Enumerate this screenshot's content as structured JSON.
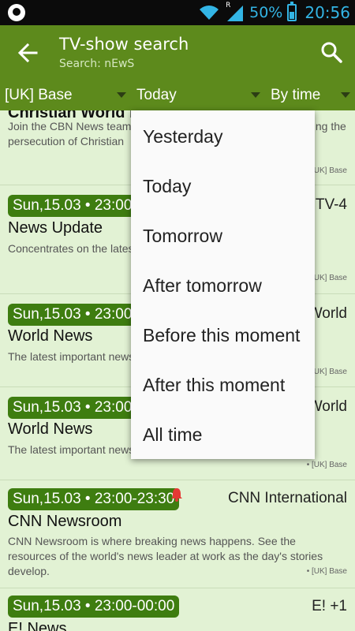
{
  "status_bar": {
    "battery_percent": "50%",
    "time": "20:56",
    "signal_label": "R",
    "accent_color": "#33b5e5"
  },
  "app_bar": {
    "title": "TV-show search",
    "subtitle": "Search: nEwS",
    "color": "#5d8a1c"
  },
  "filters": {
    "base": "[UK] Base",
    "date": "Today",
    "sort": "By time"
  },
  "list": [
    {
      "time": "",
      "channel": "",
      "title": "Christian World News",
      "description": "Join the CBN News team fo                                    f the global church with focus o                                 osing the persecution of Christian",
      "base": "• [UK] Base"
    },
    {
      "time": "Sun,15.03 • 23:00-2",
      "channel": "CTV-4",
      "title": "News Update",
      "description": "Concentrates on the latest                              China and all over the world.",
      "base": "• [UK] Base"
    },
    {
      "time": "Sun,15.03 • 23:00-2",
      "channel": "World",
      "title": "World News",
      "description": "The latest important news",
      "base": "• [UK] Base"
    },
    {
      "time": "Sun,15.03 • 23:00-2",
      "channel": "World",
      "title": "World News",
      "description": "The latest important news",
      "base": "• [UK] Base"
    },
    {
      "time": "Sun,15.03 • 23:00-23:30",
      "channel": "CNN International",
      "title": "CNN Newsroom",
      "description": "CNN Newsroom is where breaking news happens. See the resources of the world's news leader at work as the day's stories develop.",
      "base": "• [UK] Base"
    },
    {
      "time": "Sun,15.03 • 23:00-00:00",
      "channel": "E! +1",
      "title": "E! News",
      "description": "",
      "base": ""
    }
  ],
  "dropdown": {
    "options": [
      "Yesterday",
      "Today",
      "Tomorrow",
      "After tomorrow",
      "Before this moment",
      "After this moment",
      "All time"
    ]
  }
}
